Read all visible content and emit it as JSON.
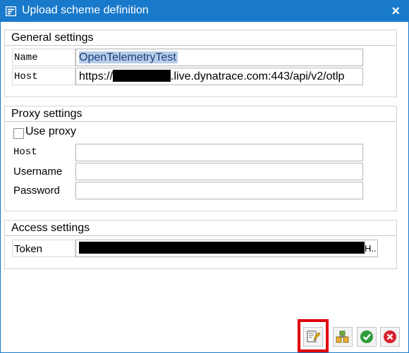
{
  "window": {
    "title": "Upload scheme definition",
    "titlebar_color": "#1979ca"
  },
  "general": {
    "title": "General settings",
    "name_label": "Name",
    "name_value": "OpenTelemetryTest",
    "host_label": "Host",
    "host_prefix": "https://",
    "host_suffix": ".live.dynatrace.com:443/api/v2/otlp"
  },
  "proxy": {
    "title": "Proxy settings",
    "use_proxy_label": "Use proxy",
    "use_proxy_checked": false,
    "host_label": "Host",
    "username_label": "Username",
    "password_label": "Password",
    "host_value": "",
    "username_value": "",
    "password_value": ""
  },
  "access": {
    "title": "Access settings",
    "token_label": "Token",
    "token_tail": "H..."
  },
  "toolbar": {
    "buttons": [
      "edit-icon",
      "transport-icon",
      "confirm-icon",
      "cancel-icon"
    ],
    "highlight_color": "#e0000d"
  }
}
